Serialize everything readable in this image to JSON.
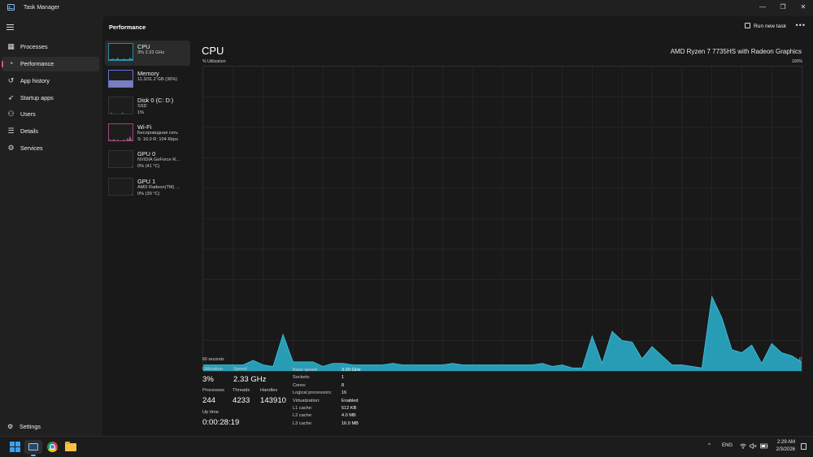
{
  "window": {
    "title": "Task Manager",
    "minimize_glyph": "—",
    "maximize_glyph": "❐",
    "close_glyph": "✕"
  },
  "nav": {
    "items": [
      {
        "label": "Processes",
        "icon": "processes-icon",
        "glyph": "▦"
      },
      {
        "label": "Performance",
        "icon": "performance-icon",
        "glyph": "◔",
        "active": true
      },
      {
        "label": "App history",
        "icon": "history-icon",
        "glyph": "↺"
      },
      {
        "label": "Startup apps",
        "icon": "startup-icon",
        "glyph": "➶"
      },
      {
        "label": "Users",
        "icon": "users-icon",
        "glyph": "⚇"
      },
      {
        "label": "Details",
        "icon": "details-icon",
        "glyph": "☰"
      },
      {
        "label": "Services",
        "icon": "services-icon",
        "glyph": "⚙"
      }
    ],
    "settings": {
      "label": "Settings",
      "glyph": "⚙"
    }
  },
  "header": {
    "title": "Performance",
    "run_new_task": "Run new task",
    "more": "•••"
  },
  "devices": [
    {
      "name": "CPU",
      "sub1": "3% 2.33 GHz",
      "sub2": "",
      "color": "#2ab0cc",
      "active": true
    },
    {
      "name": "Memory",
      "sub1": "11.3/31.2 GB (36%)",
      "sub2": "",
      "color": "#8a8fdc"
    },
    {
      "name": "Disk 0 (C: D:)",
      "sub1": "SSD",
      "sub2": "1%",
      "color": "#6fbf73"
    },
    {
      "name": "Wi-Fi",
      "sub1": "Беспроводная сеть",
      "sub2": "S: 16.0 R: 104 Kbps",
      "color": "#d65f9a"
    },
    {
      "name": "GPU 0",
      "sub1": "NVIDIA GeForce R...",
      "sub2": "0% (41 °C)",
      "color": "#7c9ee0"
    },
    {
      "name": "GPU 1",
      "sub1": "AMD Radeon(TM) ...",
      "sub2": "0% (39 °C)",
      "color": "#7c9ee0"
    }
  ],
  "cpu": {
    "title": "CPU",
    "model": "AMD Ryzen 7 7735HS with Radeon Graphics",
    "util_label": "% Utilization",
    "max_label": "100%",
    "x_left_label": "60 seconds",
    "x_right_label": "0",
    "accent": "#2aa7c2",
    "stats": {
      "utilization_label": "Utilization",
      "utilization": "3%",
      "speed_label": "Speed",
      "speed": "2.33 GHz",
      "processes_label": "Processes",
      "processes": "244",
      "threads_label": "Threads",
      "threads": "4233",
      "handles_label": "Handles",
      "handles": "143910",
      "uptime_label": "Up time",
      "uptime": "0:00:28:19"
    },
    "details": [
      {
        "key": "Base speed:",
        "value": "3.20 GHz"
      },
      {
        "key": "Sockets:",
        "value": "1"
      },
      {
        "key": "Cores:",
        "value": "8"
      },
      {
        "key": "Logical processors:",
        "value": "16"
      },
      {
        "key": "Virtualization:",
        "value": "Enabled"
      },
      {
        "key": "L1 cache:",
        "value": "512 KB"
      },
      {
        "key": "L2 cache:",
        "value": "4.0 MB"
      },
      {
        "key": "L3 cache:",
        "value": "16.0 MB"
      }
    ]
  },
  "chart_data": {
    "type": "area",
    "x": [
      60,
      59,
      58,
      57,
      56,
      55,
      54,
      53,
      52,
      51,
      50,
      49,
      48,
      47,
      46,
      45,
      44,
      43,
      42,
      41,
      40,
      39,
      38,
      37,
      36,
      35,
      34,
      33,
      32,
      31,
      30,
      29,
      28,
      27,
      26,
      25,
      24,
      23,
      22,
      21,
      20,
      19,
      18,
      17,
      16,
      15,
      14,
      13,
      12,
      11,
      10,
      9,
      8,
      7,
      6,
      5,
      4,
      3,
      2,
      1,
      0
    ],
    "series": [
      {
        "values": [
          2,
          2,
          2,
          2,
          2,
          3.5,
          2,
          1.5,
          12,
          3,
          3,
          3,
          1.5,
          2.5,
          2.5,
          2,
          2,
          2,
          2,
          2.5,
          2,
          2,
          2,
          2,
          2,
          2.5,
          2,
          2,
          2,
          2,
          2,
          2,
          2,
          2,
          2.5,
          1.5,
          2,
          1,
          1,
          11.5,
          2.5,
          13,
          10,
          9.5,
          4,
          8,
          5,
          2,
          2,
          1.5,
          1,
          24.5,
          17.5,
          7,
          6,
          8.5,
          2.5,
          9,
          6,
          5,
          3
        ]
      }
    ],
    "ylim": [
      0,
      100
    ]
  },
  "taskbar": {
    "tray_chevron": "^",
    "lang": "ENG",
    "time": "2:29 AM",
    "date": "2/3/2026"
  }
}
